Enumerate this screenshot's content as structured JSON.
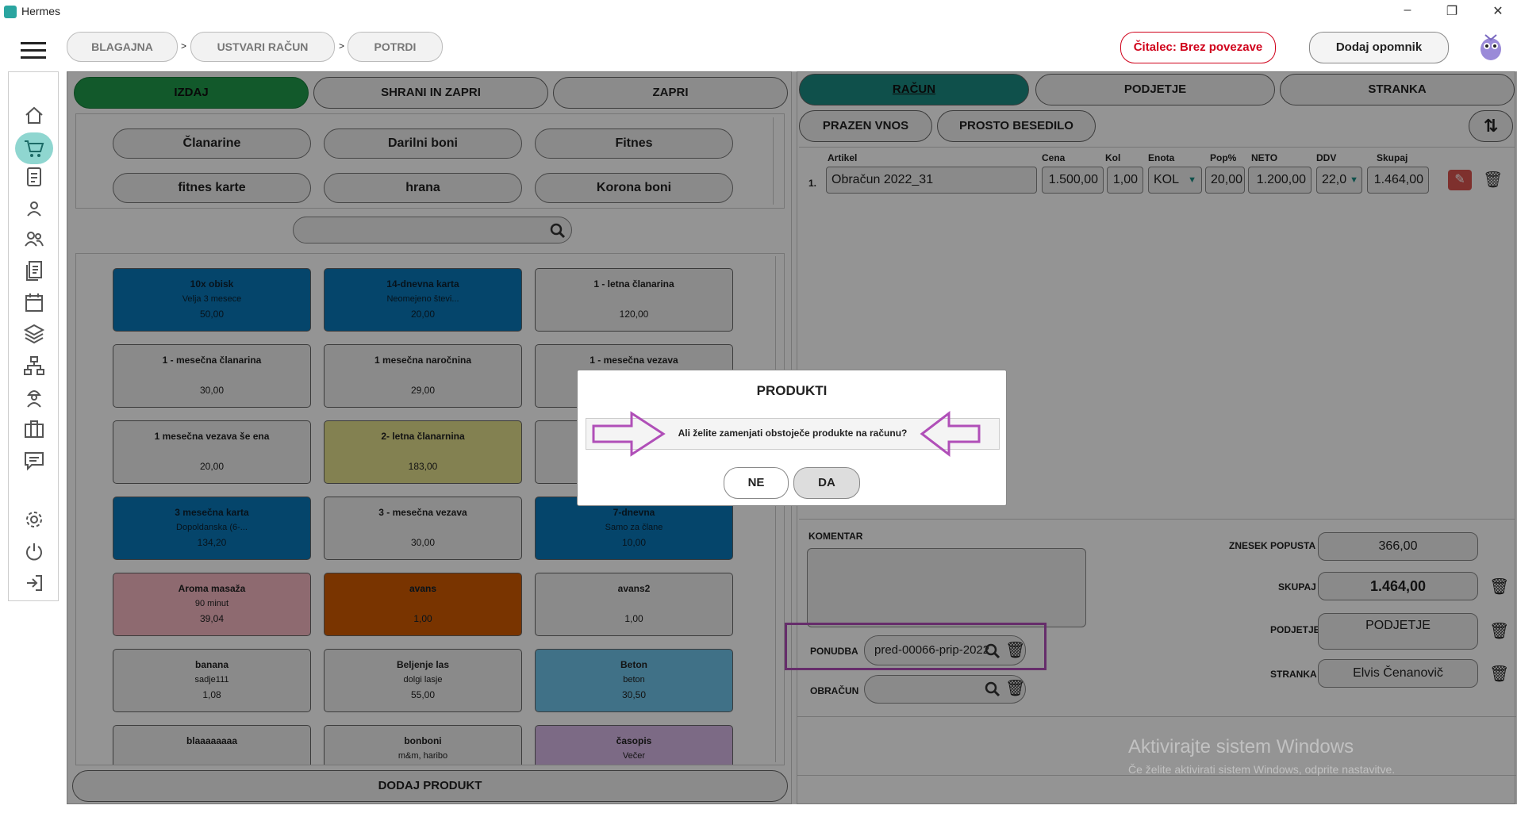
{
  "app": {
    "title": "Hermes"
  },
  "breadcrumb": [
    "BLAGAJNA",
    "USTVARI RAČUN",
    "POTRDI"
  ],
  "breadcrumb_sep": ">",
  "header": {
    "reader_status": "Čitalec: Brez povezave",
    "add_reminder": "Dodaj opomnik"
  },
  "left": {
    "actions": {
      "issue": "IZDAJ",
      "save_close": "SHRANI IN ZAPRI",
      "close": "ZAPRI"
    },
    "categories": [
      "Članarine",
      "Darilni boni",
      "Fitnes",
      "fitnes karte",
      "hrana",
      "Korona boni"
    ],
    "search_placeholder": "",
    "products": [
      {
        "name": "10x obisk",
        "sub": "Velja 3 mesece",
        "price": "50,00",
        "color": "#0a78b8"
      },
      {
        "name": "14-dnevna karta",
        "sub": "Neomejeno števi...",
        "price": "20,00",
        "color": "#0a78b8"
      },
      {
        "name": "1 - letna članarina",
        "sub": "",
        "price": "120,00",
        "color": "#eeeeee"
      },
      {
        "name": "1 - mesečna članarina",
        "sub": "",
        "price": "30,00",
        "color": "#eeeeee"
      },
      {
        "name": "1 mesečna naročnina",
        "sub": "",
        "price": "29,00",
        "color": "#eeeeee"
      },
      {
        "name": "1 - mesečna vezava",
        "sub": "",
        "price": "",
        "color": "#eeeeee"
      },
      {
        "name": "1 mesečna vezava še ena",
        "sub": "",
        "price": "20,00",
        "color": "#eeeeee"
      },
      {
        "name": "2- letna članarnina",
        "sub": "",
        "price": "183,00",
        "color": "#e2df8c"
      },
      {
        "name": "",
        "sub": "",
        "price": "",
        "color": "#eeeeee"
      },
      {
        "name": "3 mesečna karta",
        "sub": "Dopoldanska (6-...",
        "price": "134,20",
        "color": "#0a78b8"
      },
      {
        "name": "3 - mesečna vezava",
        "sub": "",
        "price": "30,00",
        "color": "#eeeeee"
      },
      {
        "name": "7-dnevna",
        "sub": "Samo za člane",
        "price": "10,00",
        "color": "#0a78b8"
      },
      {
        "name": "Aroma masaža",
        "sub": "90 minut",
        "price": "39,04",
        "color": "#f4b7c2"
      },
      {
        "name": "avans",
        "sub": "",
        "price": "1,00",
        "color": "#d05a00"
      },
      {
        "name": "avans2",
        "sub": "",
        "price": "1,00",
        "color": "#eeeeee"
      },
      {
        "name": "banana",
        "sub": "sadje111",
        "price": "1,08",
        "color": "#eeeeee"
      },
      {
        "name": "Beljenje las",
        "sub": "dolgi lasje",
        "price": "55,00",
        "color": "#eeeeee"
      },
      {
        "name": "Beton",
        "sub": "beton",
        "price": "30,50",
        "color": "#6fc3e8"
      },
      {
        "name": "blaaaaaaaa",
        "sub": "",
        "price": "",
        "color": "#eeeeee"
      },
      {
        "name": "bonboni",
        "sub": "m&m, haribo",
        "price": "",
        "color": "#eeeeee"
      },
      {
        "name": "časopis",
        "sub": "Večer",
        "price": "",
        "color": "#d6b7e6"
      }
    ],
    "add_product": "DODAJ PRODUKT"
  },
  "right": {
    "tabs": [
      "RAČUN",
      "PODJETJE",
      "STRANKA"
    ],
    "empty_entry": "PRAZEN VNOS",
    "free_text": "PROSTO BESEDILO",
    "columns": [
      "Artikel",
      "Cena",
      "Kol",
      "Enota",
      "Pop%",
      "NETO",
      "DDV",
      "Skupaj"
    ],
    "line": {
      "no": "1.",
      "article": "Obračun 2022_31",
      "price": "1.500,00",
      "qty": "1,00",
      "unit": "KOL",
      "discount": "20,00",
      "net": "1.200,00",
      "vat": "22,0",
      "total": "1.464,00"
    },
    "comment_label": "KOMENTAR",
    "offer_label": "PONUDBA",
    "offer_value": "pred-00066-prip-2022",
    "invoice_label": "OBRAČUN",
    "discount_amount_label": "ZNESEK POPUSTA",
    "discount_amount": "366,00",
    "total_label": "SKUPAJ",
    "total": "1.464,00",
    "company_label": "PODJETJE",
    "company_value": "PODJETJE",
    "customer_label": "STRANKA",
    "customer_value": "Elvis Čenanovič",
    "watermark_title": "Aktivirajte sistem Windows",
    "watermark_sub": "Če želite aktivirati sistem Windows, odprite nastavitve."
  },
  "dialog": {
    "title": "PRODUKTI",
    "message": "Ali želite zamenjati obstoječe produkte na računu?",
    "no": "NE",
    "yes": "DA"
  },
  "colors": {
    "accent": "#1f7a3c",
    "teal": "#1b8a82",
    "annotation": "#b04fb8",
    "reader": "#d0021b"
  }
}
